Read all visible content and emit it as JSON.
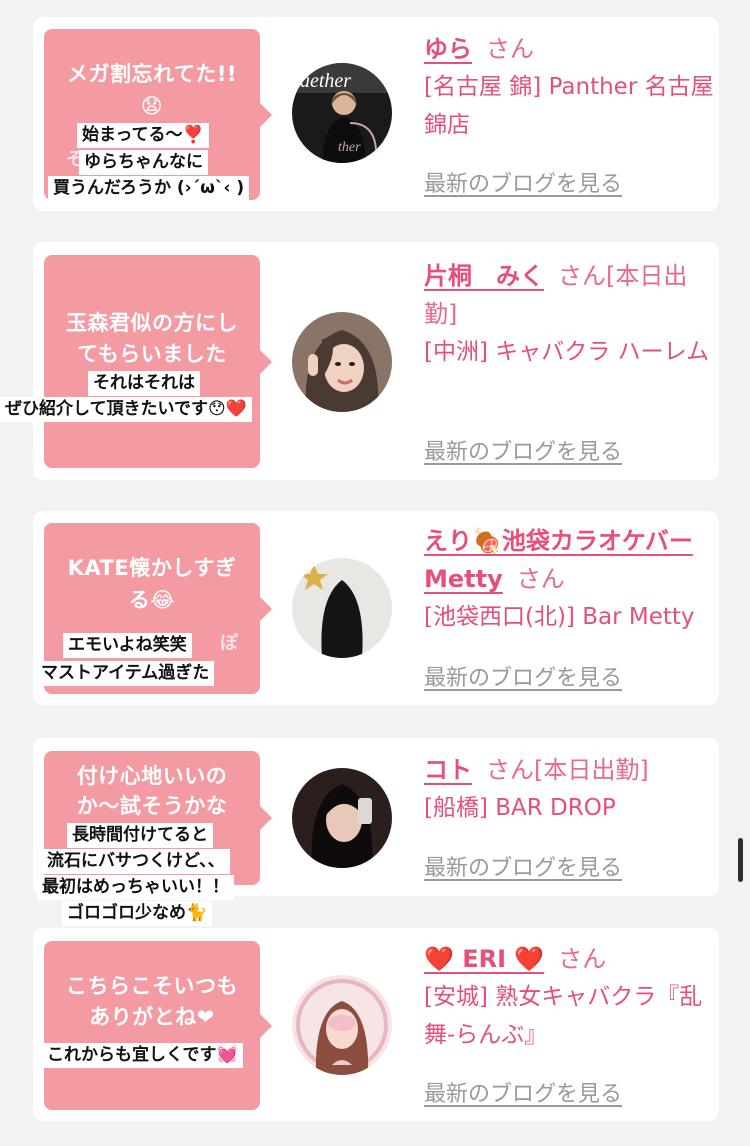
{
  "blog_link_label": "最新のブログを見る",
  "colors": {
    "accent_pink": "#e64f79",
    "bubble_pink": "#f39aa3",
    "link_gray": "#9a9a9a",
    "background": "#f2f2f4"
  },
  "entries": [
    {
      "bubble_lines": [
        "メガ割忘れてた!!",
        "😧"
      ],
      "bubble_hidden_text": "そ",
      "caption_lines": [
        "始まってる〜❣️",
        "ゆらちゃんなに",
        "買うんだろうか (›´ω`‹ )"
      ],
      "name": "ゆら",
      "name_suffix": "さん",
      "shop": "[名古屋 錦] Panther 名古屋錦店",
      "avatar_desc": "woman in black outfit with Panther logo"
    },
    {
      "bubble_lines": [
        "玉森君似の方にし",
        "てもらいました"
      ],
      "caption_lines": [
        "それはそれは",
        "ぜひ紹介して頂きたいです😯❤️"
      ],
      "name": "片桐　みく",
      "name_suffix": "さん[本日出勤]",
      "shop": "[中洲] キャバクラ ハーレム",
      "avatar_desc": "woman with peace sign"
    },
    {
      "bubble_lines": [
        "KATE懐かしすぎ",
        "る😂"
      ],
      "bubble_hidden_text": "ぽ",
      "caption_lines": [
        "エモいよね笑笑",
        "マストアイテム過ぎた"
      ],
      "name": "えり🍖池袋カラオケバーMetty",
      "name_suffix": "さん",
      "shop": "[池袋西口(北)] Bar Metty",
      "avatar_desc": "long black hair from behind with star"
    },
    {
      "bubble_lines": [
        "付け心地いいの",
        "か〜試そうかな"
      ],
      "caption_lines": [
        "長時間付けてると",
        "流石にバサつくけど、、",
        "最初はめっちゃいい！！",
        "ゴロゴロ少なめ🐈"
      ],
      "name": "コト",
      "name_suffix": "さん[本日出勤]",
      "shop": "[船橋] BAR DROP",
      "avatar_desc": "woman with dark hair in dim light"
    },
    {
      "bubble_lines": [
        "こちらこそいつも",
        "ありがとね❤"
      ],
      "caption_lines": [
        "これからも宜しくです💓"
      ],
      "name": "❤️ ERI ❤️",
      "name_suffix": "さん",
      "shop": "[安城] 熟女キャバクラ『乱舞-らんぶ』",
      "avatar_desc": "woman in pink frame"
    }
  ]
}
